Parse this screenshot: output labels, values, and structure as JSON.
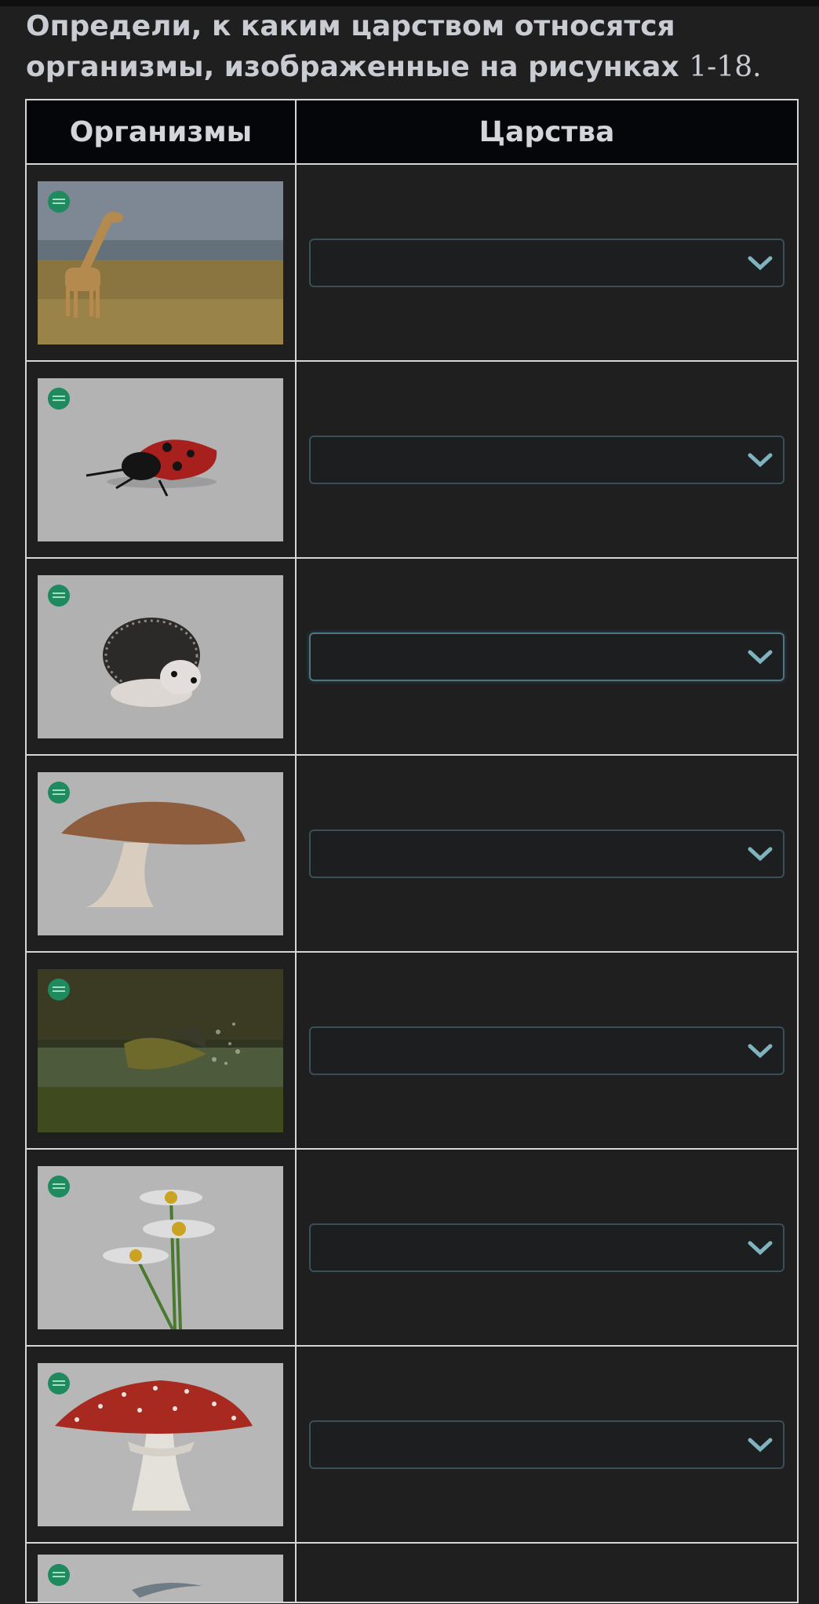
{
  "question": {
    "text_line1": "Определи, к каким царством относятся",
    "text_line2": "организмы, изображенные на рисунках",
    "range": "1-18."
  },
  "table": {
    "headers": [
      "Организмы",
      "Царства"
    ],
    "rows": [
      {
        "image": "giraffe",
        "selected": ""
      },
      {
        "image": "ladybug",
        "selected": ""
      },
      {
        "image": "hedgehog",
        "selected": ""
      },
      {
        "image": "bolete-mushroom",
        "selected": ""
      },
      {
        "image": "perch-fish",
        "selected": ""
      },
      {
        "image": "chamomile",
        "selected": ""
      },
      {
        "image": "fly-agaric",
        "selected": ""
      },
      {
        "image": "dolphin",
        "selected": ""
      }
    ]
  },
  "colors": {
    "accent": "#7fb3bd",
    "border": "#d6d6d6",
    "header_bg": "#04060a"
  }
}
